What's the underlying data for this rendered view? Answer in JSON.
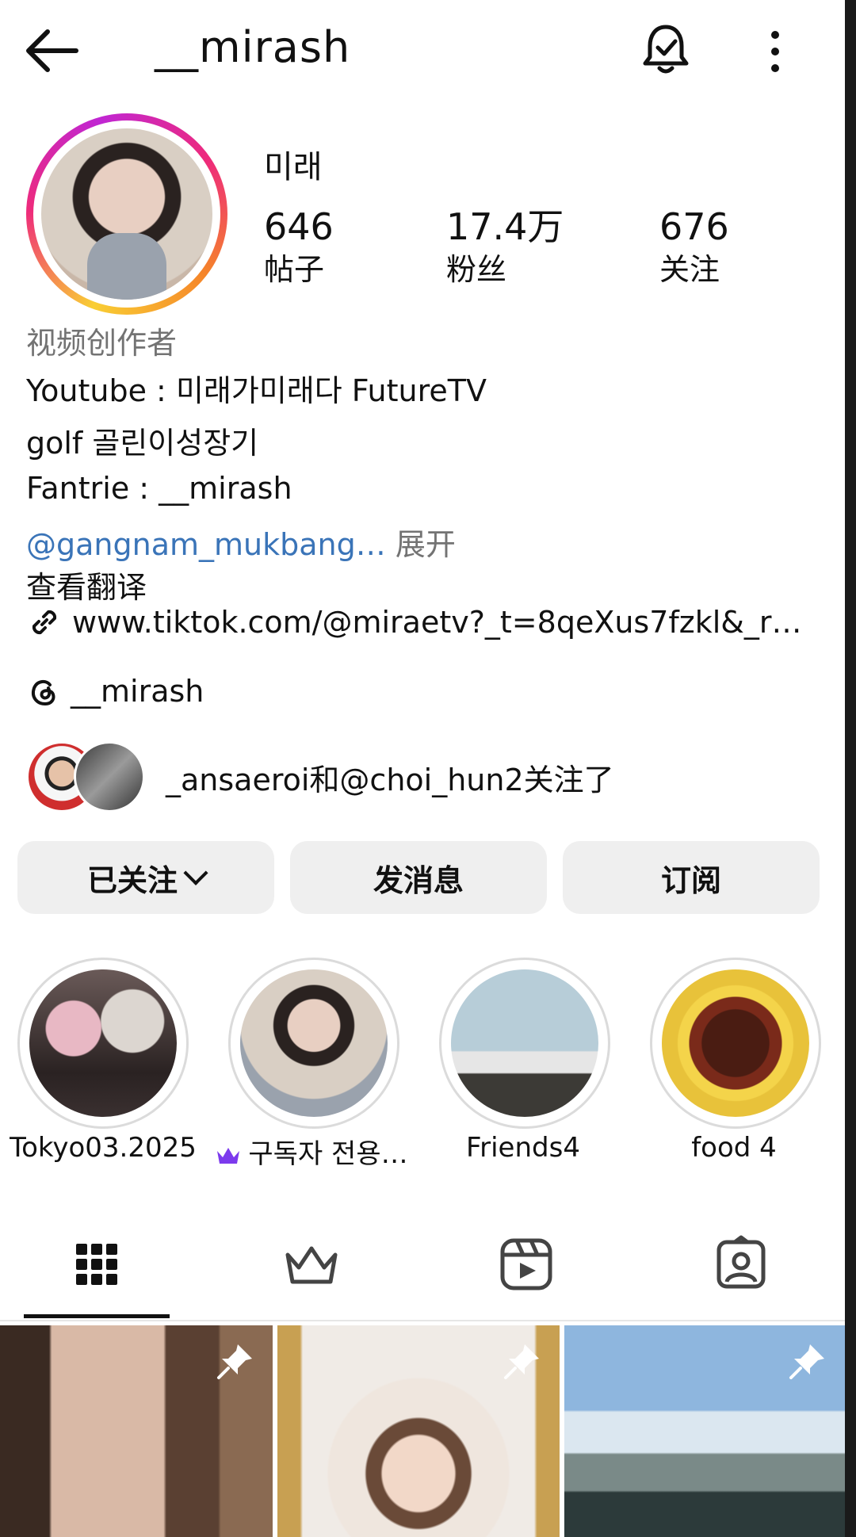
{
  "header": {
    "username": "__mirash",
    "icons": [
      "back-arrow-icon",
      "notification-bell-icon",
      "more-options-icon"
    ]
  },
  "profile": {
    "display_name": "미래",
    "stats": [
      {
        "value": "646",
        "label": "帖子"
      },
      {
        "value": "17.4万",
        "label": "粉丝"
      },
      {
        "value": "676",
        "label": "关注"
      }
    ],
    "category": "视频创作者",
    "bio_lines": [
      "Youtube : 미래가미래다 FutureTV",
      "golf 골린이성장기",
      "Fantrie : __mirash"
    ],
    "mention": "@gangnam_mukbang…",
    "expand_label": "展开",
    "translate_label": "查看翻译",
    "link": "www.tiktok.com/@miraetv?_t=8qeXus7fzkl&_r…",
    "threads_handle": "__mirash",
    "followed_by": "_ansaeroi和@choi_hun2关注了"
  },
  "actions": {
    "following": "已关注",
    "message": "发消息",
    "subscribe": "订阅"
  },
  "highlights": [
    {
      "label": "Tokyo03.2025"
    },
    {
      "label": "구독자 전용…",
      "badge": "crown-icon"
    },
    {
      "label": "Friends4"
    },
    {
      "label": "food 4"
    }
  ],
  "tabs": [
    "grid-icon",
    "crown-icon",
    "reels-icon",
    "tagged-icon"
  ],
  "colors": {
    "mention": "#3a74b8",
    "secondary_text": "#737373",
    "button_bg": "#efefef",
    "crown": "#7c3aed"
  }
}
